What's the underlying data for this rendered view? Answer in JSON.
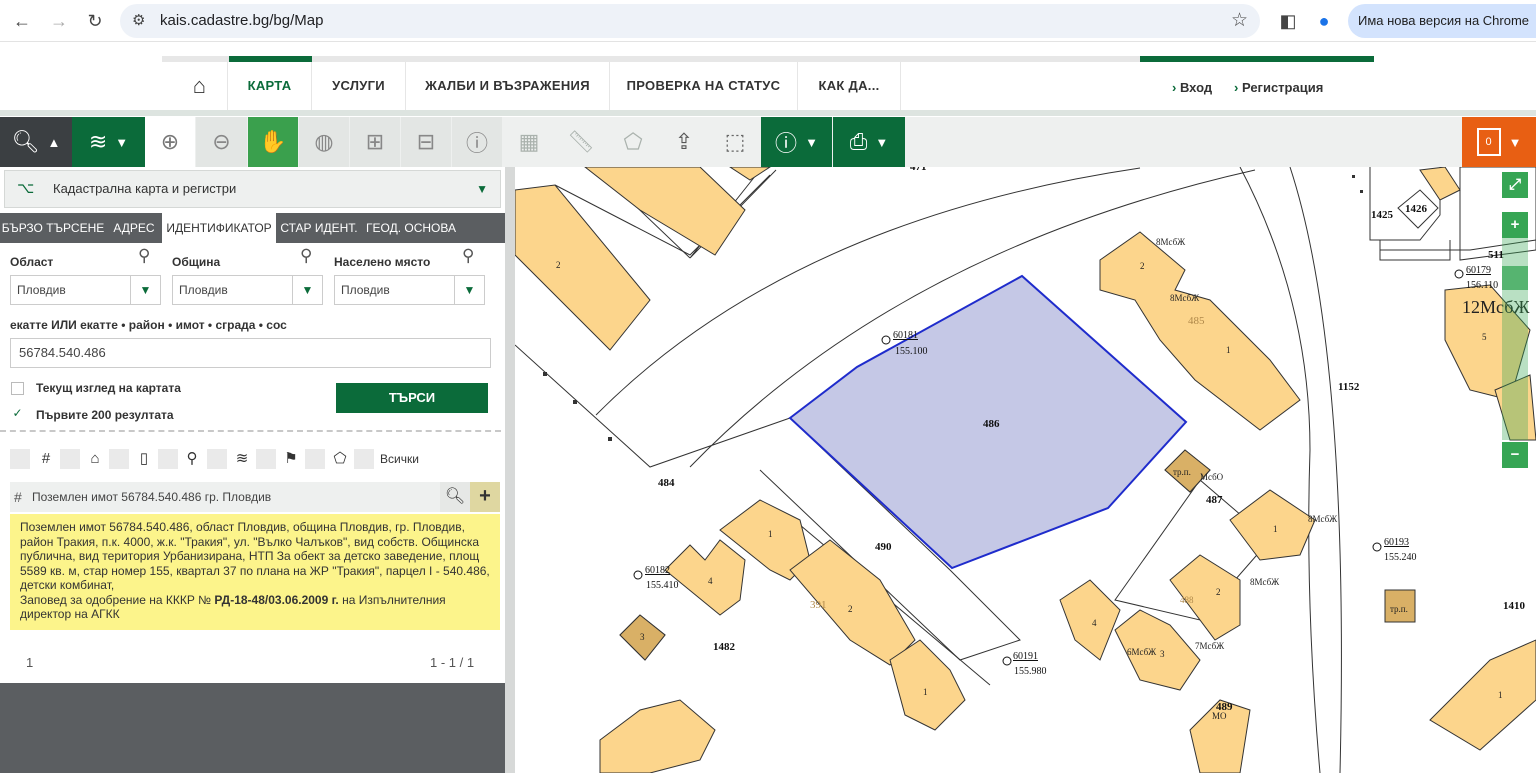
{
  "browser": {
    "url": "kais.cadastre.bg/bg/Map",
    "update_text": "Има нова версия на Chrome"
  },
  "site_nav": {
    "items": [
      "КАРТА",
      "УСЛУГИ",
      "ЖАЛБИ И ВЪЗРАЖЕНИЯ",
      "ПРОВЕРКА НА СТАТУС",
      "КАК ДА..."
    ],
    "login": "Вход",
    "register": "Регистрация"
  },
  "toolbar": {
    "cart_count": "0"
  },
  "panel": {
    "layer_select": "Кадастрална карта и регистри",
    "tabs": [
      "БЪРЗО ТЪРСЕНЕ",
      "АДРЕС",
      "ИДЕНТИФИКАТОР",
      "СТАР ИДЕНТ.",
      "ГЕОД. ОСНОВА"
    ],
    "active_tab": "ИДЕНТИФИКАТОР",
    "oblast_label": "Област",
    "oblast_value": "Пловдив",
    "obshtina_label": "Община",
    "obshtina_value": "Пловдив",
    "naseleno_label": "Населено място",
    "naseleno_value": "Пловдив",
    "id_label": "екатте ИЛИ екатте • район • имот • сграда • сос",
    "id_value": "56784.540.486",
    "current_view_label": "Текущ изглед на картата",
    "first200_label": "Първите 200 резултата",
    "search_button": "ТЪРСИ",
    "filter_all": "Всички",
    "result_title": "Поземлен имот 56784.540.486 гр. Пловдив",
    "result_info": "Поземлен имот 56784.540.486, област Пловдив, община Пловдив, гр. Пловдив, район Тракия, п.к. 4000, ж.к. \"Тракия\", ул. \"Вълко Чалъков\", вид собств. Общинска публична, вид територия Урбанизирана, НТП За обект за детско заведение, площ 5589 кв. м, стар номер 155, квартал 37 по плана на ЖР \"Тракия\", парцел I - 540.486, детски комбинат,",
    "result_order_prefix": "Заповед за одобрение на КККР №",
    "result_order_number": "РД-18-48/03.06.2009 г.",
    "result_order_suffix": "на Изпълнителния директор на АГКК",
    "page": "1",
    "range": "1 - 1 / 1"
  },
  "map": {
    "parcels": [
      "486",
      "484",
      "490",
      "487",
      "1482",
      "1152",
      "1425",
      "1426",
      "1410",
      "489",
      "511",
      "471"
    ],
    "geodetic_points": [
      {
        "id": "60181",
        "elev": "155.100"
      },
      {
        "id": "60182",
        "elev": "155.410"
      },
      {
        "id": "60191",
        "elev": "155.980"
      },
      {
        "id": "60193",
        "elev": "155.240"
      },
      {
        "id": "60179",
        "elev": "156.110"
      }
    ],
    "building_labels": [
      "8МсбЖ",
      "8МсбЖ",
      "1",
      "2",
      "485",
      "тр.п.",
      "МсбО",
      "8МсбЖ",
      "8МсбЖ",
      "1",
      "2",
      "3",
      "4",
      "488",
      "6МсбЖ",
      "7МсбЖ",
      "тр.п.",
      "12МсбЖ",
      "5",
      "МО",
      "3",
      "4",
      "1",
      "2",
      "391",
      "1",
      "1",
      "2"
    ],
    "selected_fill": "#c5c8e6",
    "selected_stroke": "#1f2ccc",
    "building_fill": "#fcd58c"
  }
}
